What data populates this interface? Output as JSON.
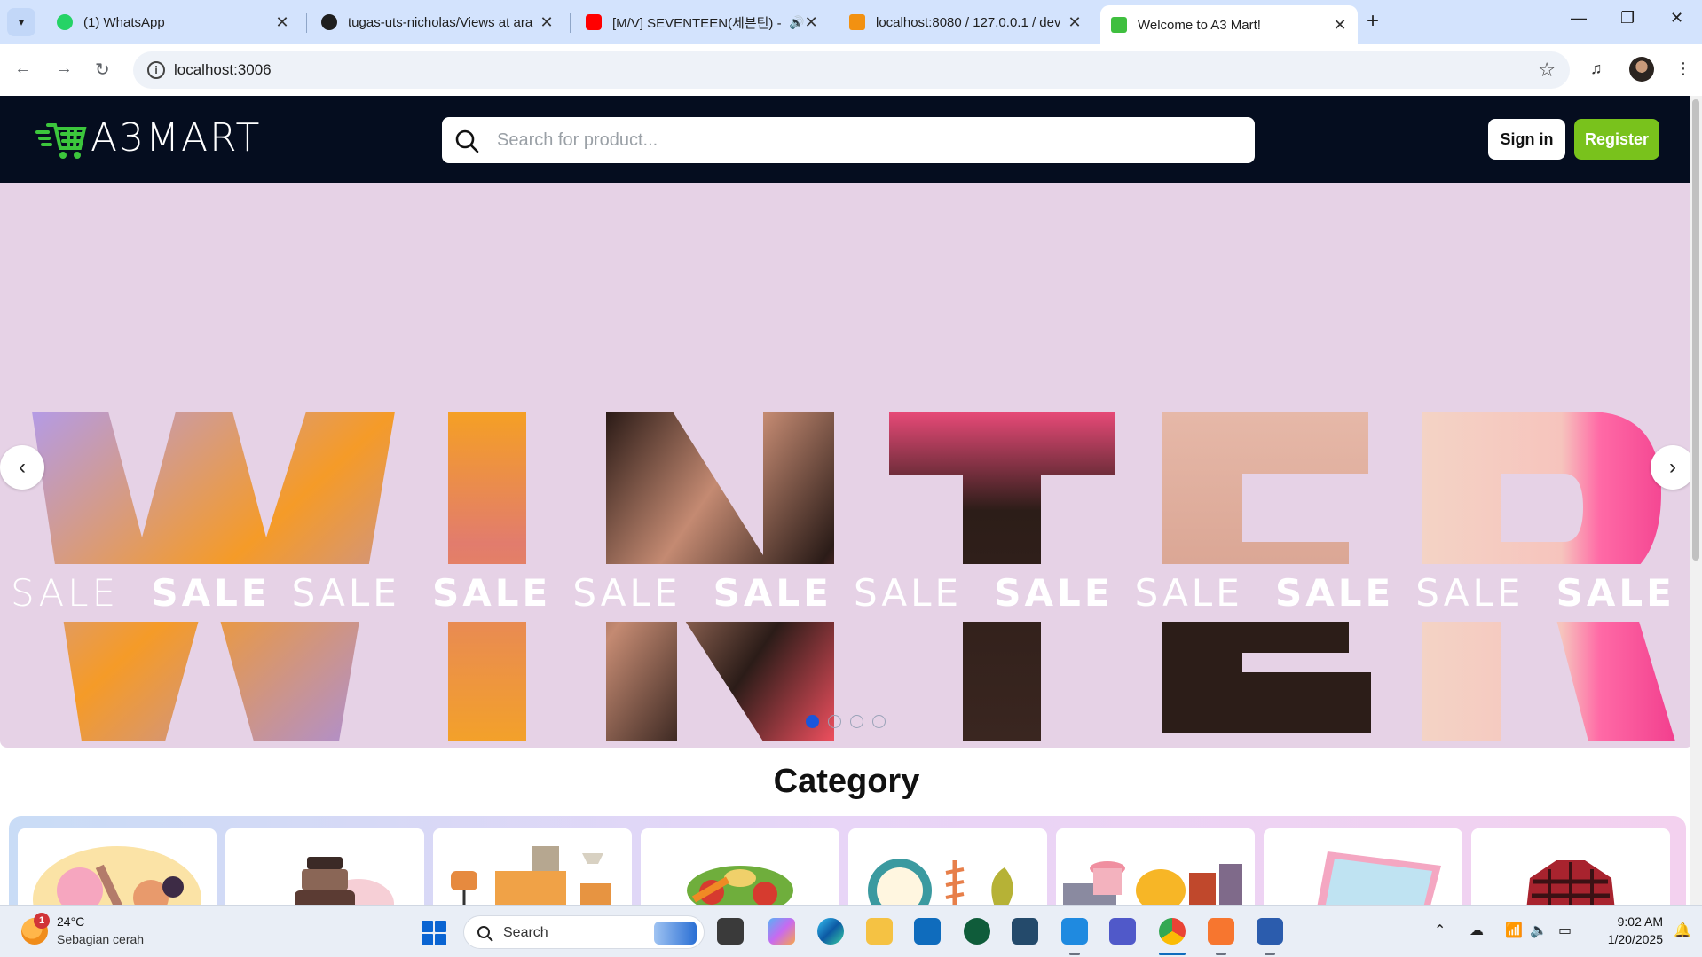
{
  "browser": {
    "tabs": [
      {
        "title": "(1) WhatsApp",
        "icon": "whatsapp-icon"
      },
      {
        "title": "tugas-uts-nicholas/Views at ara",
        "icon": "github-icon"
      },
      {
        "title": "[M/V] SEVENTEEN(세븐틴) -",
        "icon": "youtube-icon"
      },
      {
        "title": "localhost:8080 / 127.0.0.1 / dev",
        "icon": "phpmyadmin-icon"
      },
      {
        "title": "Welcome to A3 Mart!",
        "icon": "a3mart-cart-icon",
        "active": true
      }
    ],
    "url": "localhost:3006"
  },
  "site": {
    "logo_text": "A3MART",
    "search_placeholder": "Search for product...",
    "signin_label": "Sign in",
    "register_label": "Register",
    "colors": {
      "header_bg": "#050d1f",
      "accent_green": "#79c21c",
      "hero_bg": "#e6d2e6"
    }
  },
  "hero": {
    "headline_big": "WINTER",
    "sale_band": [
      "SALE",
      "SALE",
      "SALE",
      "SALE",
      "SALE",
      "SALE",
      "SALE",
      "SALE",
      "SALE",
      "SALE",
      "SALE",
      "SALE"
    ],
    "slide_count": 4,
    "active_slide": 1
  },
  "category": {
    "title": "Category",
    "cards": [
      "beauty-illustration",
      "perfume-illustration",
      "furniture-illustration",
      "vegetables-illustration",
      "clock-plants-illustration",
      "kitchenware-illustration",
      "laptop-illustration",
      "flannel-shirt-illustration"
    ]
  },
  "taskbar": {
    "weather_temp": "24°C",
    "weather_desc": "Sebagian cerah",
    "weather_badge": "1",
    "search_label": "Search",
    "time": "9:02 AM",
    "date": "1/20/2025"
  }
}
